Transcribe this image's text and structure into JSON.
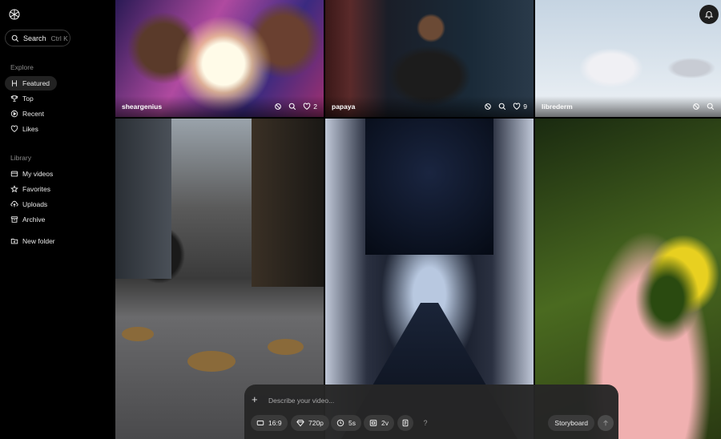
{
  "sidebar": {
    "logo_icon": "openai-logo-icon",
    "search": {
      "label": "Search",
      "shortcut": "Ctrl K"
    },
    "explore_label": "Explore",
    "explore_items": [
      {
        "label": "Featured",
        "icon": "featured-icon",
        "active": true
      },
      {
        "label": "Top",
        "icon": "trophy-icon",
        "active": false
      },
      {
        "label": "Recent",
        "icon": "recent-icon",
        "active": false
      },
      {
        "label": "Likes",
        "icon": "heart-icon",
        "active": false
      }
    ],
    "library_label": "Library",
    "library_items": [
      {
        "label": "My videos",
        "icon": "videos-icon"
      },
      {
        "label": "Favorites",
        "icon": "star-icon"
      },
      {
        "label": "Uploads",
        "icon": "upload-icon"
      },
      {
        "label": "Archive",
        "icon": "archive-icon"
      }
    ],
    "new_folder": {
      "label": "New folder",
      "icon": "new-folder-icon"
    }
  },
  "grid": {
    "tiles": [
      {
        "user": "sheargenius",
        "likes": "2"
      },
      {
        "user": "papaya",
        "likes": "9"
      },
      {
        "user": "librederm",
        "likes": ""
      }
    ]
  },
  "composer": {
    "placeholder": "Describe your video...",
    "aspect": "16:9",
    "resolution": "720p",
    "duration": "5s",
    "variations": "2v",
    "help": "?",
    "storyboard": "Storyboard"
  }
}
